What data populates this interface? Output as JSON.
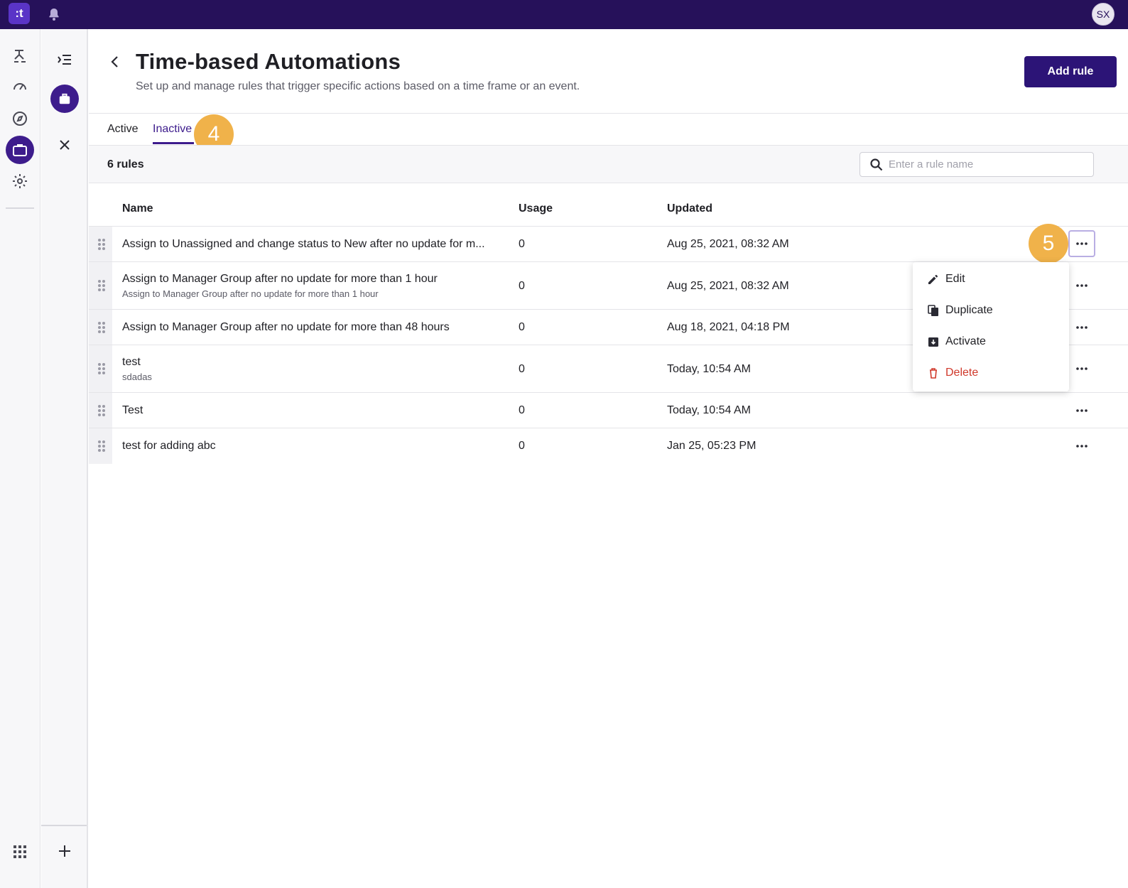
{
  "topbar": {
    "logo_text": ":t",
    "user_initials": "SX"
  },
  "page": {
    "title": "Time-based Automations",
    "subtitle": "Set up and manage rules that trigger specific actions based on a time frame or an event.",
    "add_rule_label": "Add rule"
  },
  "tabs": [
    {
      "label": "Active",
      "selected": false
    },
    {
      "label": "Inactive",
      "selected": true
    }
  ],
  "annotations": {
    "step_4": "4",
    "step_5": "5"
  },
  "toolbar": {
    "rules_count": "6 rules",
    "search_placeholder": "Enter a rule name"
  },
  "table": {
    "headers": {
      "name": "Name",
      "usage": "Usage",
      "updated": "Updated"
    },
    "rows": [
      {
        "name": "Assign to Unassigned and change status to New after no update for m...",
        "description": "",
        "usage": "0",
        "updated": "Aug 25, 2021, 08:32 AM"
      },
      {
        "name": "Assign to Manager Group after no update for more than 1 hour",
        "description": "Assign to Manager Group after no update for more than 1 hour",
        "usage": "0",
        "updated": "Aug 25, 2021, 08:32 AM"
      },
      {
        "name": "Assign to Manager Group after no update for more than 48 hours",
        "description": "",
        "usage": "0",
        "updated": "Aug 18, 2021, 04:18 PM"
      },
      {
        "name": "test",
        "description": "sdadas",
        "usage": "0",
        "updated": "Today, 10:54 AM"
      },
      {
        "name": "Test",
        "description": "",
        "usage": "0",
        "updated": "Today, 10:54 AM"
      },
      {
        "name": "test for adding abc",
        "description": "",
        "usage": "0",
        "updated": "Jan 25, 05:23 PM"
      }
    ]
  },
  "row_menu": {
    "items": [
      {
        "label": "Edit",
        "icon": "pencil-icon"
      },
      {
        "label": "Duplicate",
        "icon": "duplicate-icon"
      },
      {
        "label": "Activate",
        "icon": "activate-icon"
      },
      {
        "label": "Delete",
        "icon": "trash-icon"
      }
    ]
  },
  "colors": {
    "brand": "#26115a",
    "accent": "#3d1c8c",
    "badge": "#f0b24a",
    "danger": "#d0392b"
  }
}
